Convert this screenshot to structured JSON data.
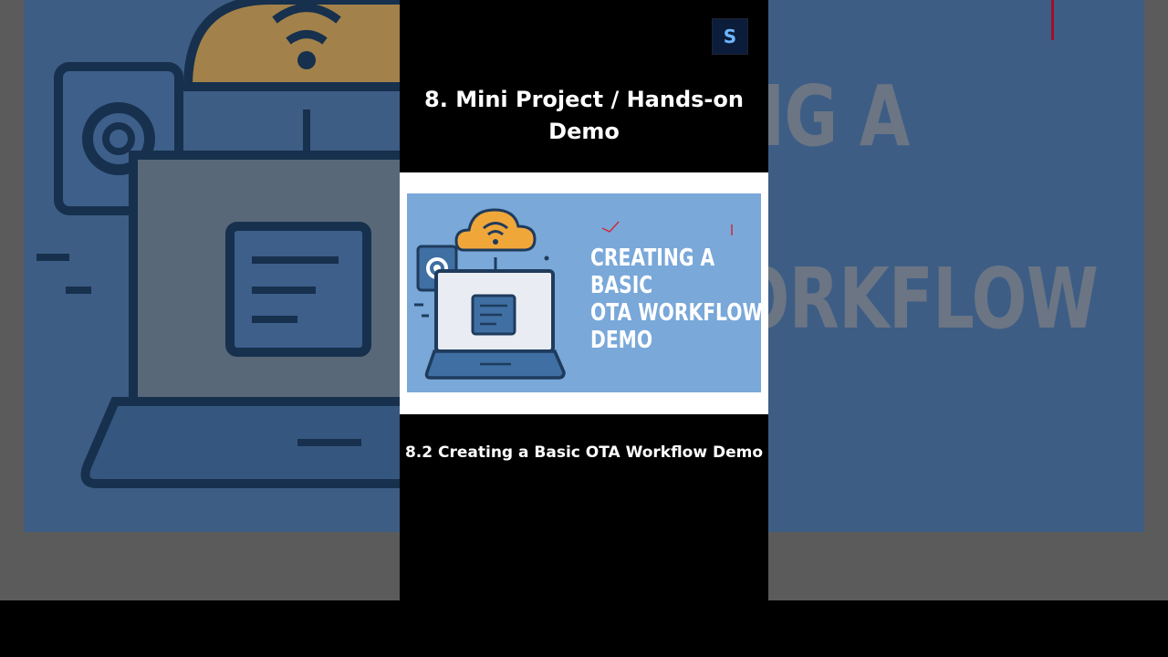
{
  "background": {
    "headline": "TING A\nC\nWORKFLOW\nO"
  },
  "channel": {
    "logo_text": "S",
    "logo_icon": "channel-logo-icon"
  },
  "slide": {
    "heading": "8. Mini Project / Hands-on Demo",
    "thumbnail_title": "CREATING A\nBASIC\nOTA WORKFLOW\nDEMO",
    "caption": "8.2 Creating a Basic OTA Workflow Demo"
  },
  "colors": {
    "thumbnail_bg": "#79a8d9",
    "cloud": "#f0a73a",
    "icon_dark": "#1f3b5c",
    "accent_red": "#d0283a"
  }
}
